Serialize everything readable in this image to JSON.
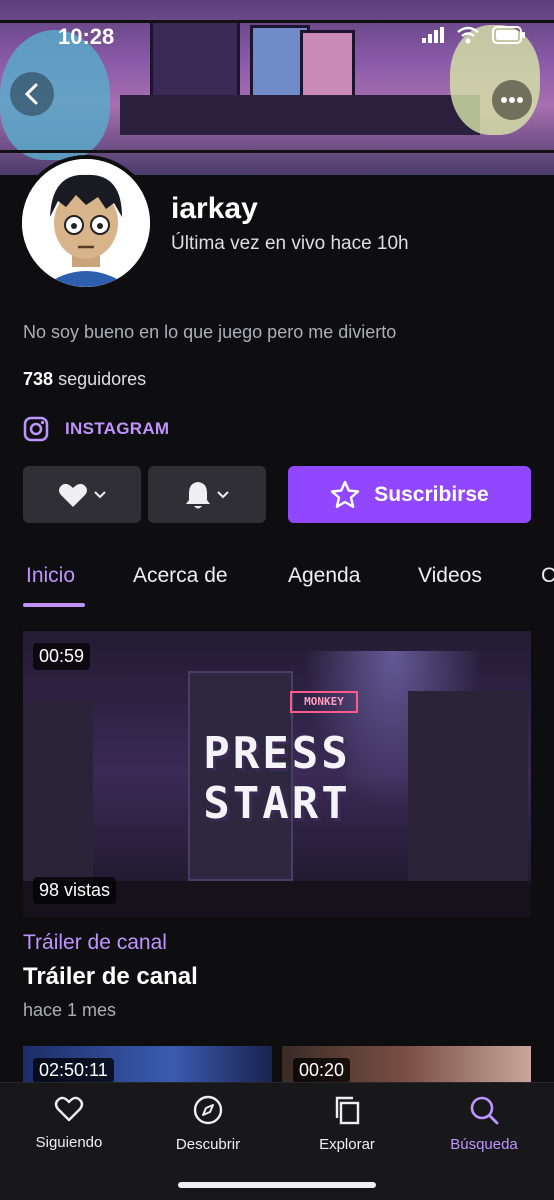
{
  "status_bar": {
    "time": "10:28"
  },
  "channel": {
    "name": "iarkay",
    "last_live": "Última vez en vivo hace 10h",
    "bio": "No soy bueno en lo que juego pero me divierto",
    "followers_count": "738",
    "followers_label": "seguidores",
    "social_label": "INSTAGRAM"
  },
  "actions": {
    "subscribe_label": "Suscribirse"
  },
  "tabs": [
    {
      "label": "Inicio",
      "active": true
    },
    {
      "label": "Acerca de",
      "active": false
    },
    {
      "label": "Agenda",
      "active": false
    },
    {
      "label": "Videos",
      "active": false
    },
    {
      "label": "C",
      "active": false
    }
  ],
  "featured_video": {
    "duration": "00:59",
    "views": "98 vistas",
    "thumbnail_text_1": "PRESS",
    "thumbnail_text_2": "START",
    "thumbnail_sign": "MONKEY",
    "category": "Tráiler de canal",
    "title": "Tráiler de canal",
    "date": "hace 1 mes"
  },
  "more_videos": [
    {
      "duration": "02:50:11"
    },
    {
      "duration": "00:20"
    }
  ],
  "bottom_nav": [
    {
      "label": "Siguiendo",
      "icon": "heart-outline-icon",
      "active": false
    },
    {
      "label": "Descubrir",
      "icon": "compass-icon",
      "active": false
    },
    {
      "label": "Explorar",
      "icon": "browse-copy-icon",
      "active": false
    },
    {
      "label": "Búsqueda",
      "icon": "search-icon",
      "active": true
    }
  ],
  "colors": {
    "accent": "#9147ff",
    "accent_text": "#bf94ff",
    "background": "#0e0e10"
  }
}
